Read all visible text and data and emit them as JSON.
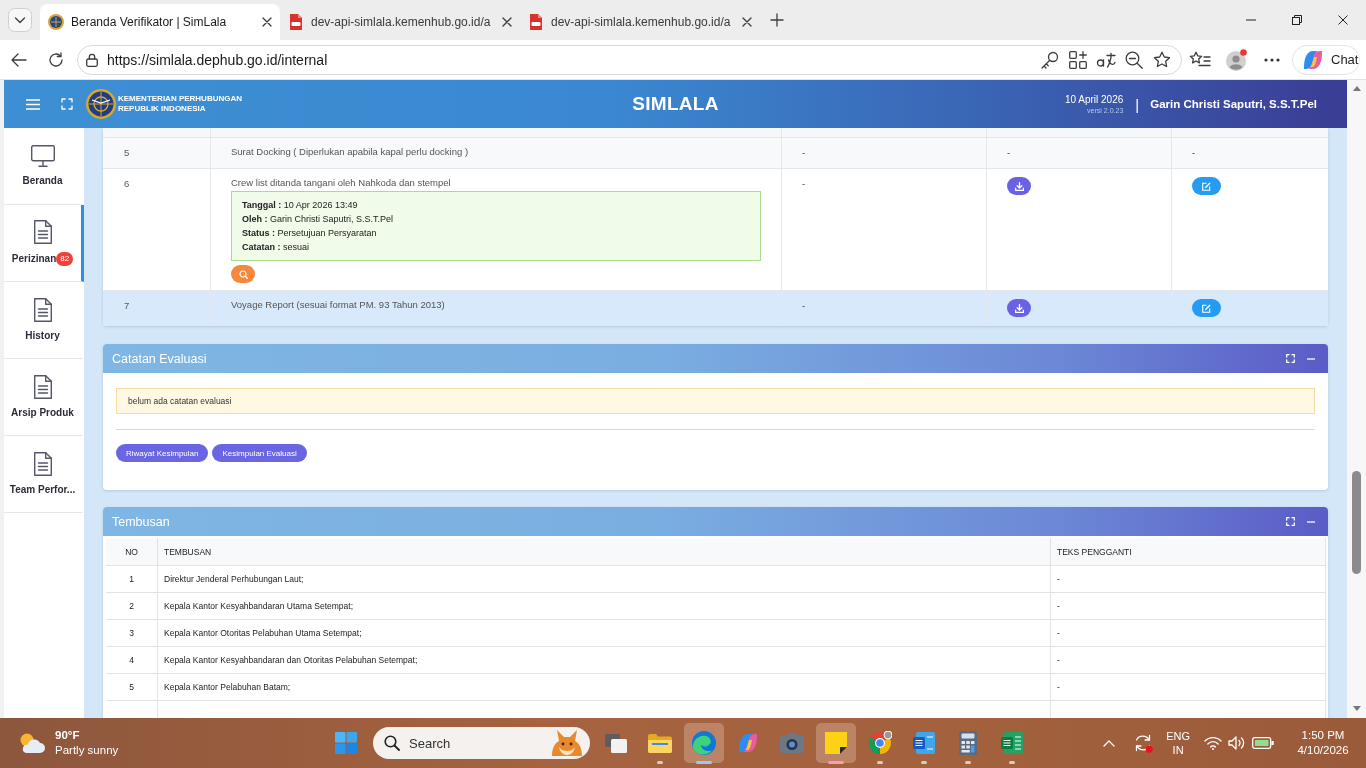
{
  "browser": {
    "tabs": [
      {
        "kind": "site",
        "title": "Beranda Verifikator | SimLala",
        "selected": true
      },
      {
        "kind": "pdf",
        "title": "dev-api-simlala.kemenhub.go.id/a",
        "selected": false
      },
      {
        "kind": "pdf",
        "title": "dev-api-simlala.kemenhub.go.id/a",
        "selected": false
      }
    ],
    "url": "https://simlala.dephub.go.id/internal",
    "chat_button": "Chat"
  },
  "header": {
    "org_name": [
      "KEMENTERIAN PERHUBUNGAN",
      "REPUBLIK INDONESIA"
    ],
    "app_title": "SIMLALA",
    "date": "10 April 2026",
    "version": "versi 2.0.23",
    "separator": "|",
    "user_name": "Garin Christi Saputri, S.S.T.Pel"
  },
  "sidebar": {
    "items": [
      {
        "kind": "home",
        "label": "Beranda",
        "selected": false
      },
      {
        "kind": "module",
        "label": "Perizinan",
        "badge": "82",
        "selected": true
      },
      {
        "kind": "module",
        "label": "History",
        "selected": false
      },
      {
        "kind": "module",
        "label": "Arsip Produk",
        "selected": false
      },
      {
        "kind": "module",
        "label": "Team Perfor...",
        "selected": false
      }
    ]
  },
  "requirements": {
    "rows": [
      {
        "no": "5",
        "name": "Surat Docking ( Diperlukan apabila kapal perlu docking )",
        "highlighted": false,
        "search_button": false,
        "cells": [
          {
            "kind": "text",
            "text": "-"
          },
          {
            "kind": "text",
            "text": "-"
          },
          {
            "kind": "text",
            "text": "-"
          }
        ]
      },
      {
        "no": "6",
        "name": "Crew list ditanda tangani oleh Nahkoda dan stempel",
        "highlighted": false,
        "note": [
          "**Tanggal :** 10 Apr 2026 13:49",
          "**Oleh :** Garin Christi Saputri, S.S.T.Pel",
          "**Status :** Persetujuan Persyaratan",
          "**Catatan :** sesuai"
        ],
        "search_button": true,
        "cells": [
          {
            "kind": "text",
            "text": "-"
          },
          {
            "kind": "download"
          },
          {
            "kind": "edit"
          }
        ]
      },
      {
        "no": "7",
        "name": "Voyage Report (sesuai format PM. 93 Tahun 2013)",
        "highlighted": true,
        "search_button": false,
        "cells": [
          {
            "kind": "text",
            "text": "-"
          },
          {
            "kind": "download"
          },
          {
            "kind": "edit"
          }
        ]
      }
    ]
  },
  "evaluation": {
    "title": "Catatan Evaluasi",
    "message": "belum ada catatan evaluasi",
    "buttons": [
      "Riwayat Kesimpulan",
      "Kesimpulan Evaluasi"
    ]
  },
  "tembusan": {
    "title": "Tembusan",
    "columns": [
      "NO",
      "TEMBUSAN",
      "TEKS PENGGANTI"
    ],
    "rows": [
      [
        "1",
        "Direktur Jenderal Perhubungan Laut;",
        "-"
      ],
      [
        "2",
        "Kepala Kantor Kesyahbandaran Utama Setempat;",
        "-"
      ],
      [
        "3",
        "Kepala Kantor Otoritas Pelabuhan Utama Setempat;",
        "-"
      ],
      [
        "4",
        "Kepala Kantor Kesyahbandaran dan Otoritas Pelabuhan Setempat;",
        "-"
      ],
      [
        "5",
        "Kepala Kantor Pelabuhan Batam;",
        "-"
      ]
    ]
  },
  "taskbar": {
    "weather": {
      "temperature": "90°F",
      "condition": "Partly sunny"
    },
    "search": {
      "placeholder": "Search"
    },
    "apps": [
      {
        "kind": "task-view",
        "running": false,
        "active": false
      },
      {
        "kind": "folder",
        "running": true,
        "active": false
      },
      {
        "kind": "edge",
        "running": true,
        "active": true
      },
      {
        "kind": "copilot",
        "running": false,
        "active": false
      },
      {
        "kind": "camera",
        "running": false,
        "active": false
      },
      {
        "kind": "sticky",
        "running": true,
        "active": true
      },
      {
        "kind": "chrome",
        "running": true,
        "active": false
      },
      {
        "kind": "word",
        "running": true,
        "active": false
      },
      {
        "kind": "calculator",
        "running": true,
        "active": false
      },
      {
        "kind": "excel",
        "running": true,
        "active": false
      }
    ],
    "tray": {
      "language": "ENG",
      "region": "IN",
      "time": "1:50 PM",
      "date": "4/10/2026"
    }
  }
}
